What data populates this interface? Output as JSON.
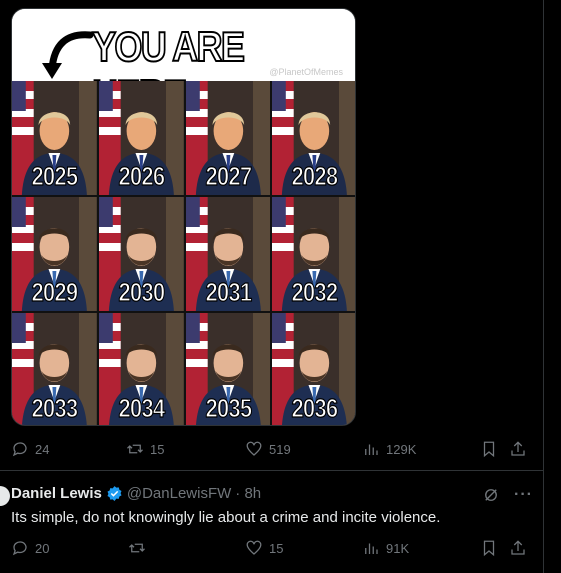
{
  "meme": {
    "title": "YOU ARE HERE.",
    "credit": "@PlanetOfMemes",
    "cells": [
      {
        "year": "2025",
        "person": "trump"
      },
      {
        "year": "2026",
        "person": "trump"
      },
      {
        "year": "2027",
        "person": "trump"
      },
      {
        "year": "2028",
        "person": "trump"
      },
      {
        "year": "2029",
        "person": "vance"
      },
      {
        "year": "2030",
        "person": "vance"
      },
      {
        "year": "2031",
        "person": "vance"
      },
      {
        "year": "2032",
        "person": "vance"
      },
      {
        "year": "2033",
        "person": "vance"
      },
      {
        "year": "2034",
        "person": "vance"
      },
      {
        "year": "2035",
        "person": "vance"
      },
      {
        "year": "2036",
        "person": "vance"
      }
    ]
  },
  "post_actions": {
    "replies": "24",
    "reposts": "15",
    "likes": "519",
    "views": "129K"
  },
  "reply": {
    "name": "Daniel Lewis",
    "handle": "@DanLewisFW",
    "time": "· 8h",
    "text": "Its simple, do not knowingly lie about a crime and incite violence.",
    "more_label": "···",
    "actions": {
      "replies": "20",
      "reposts": "",
      "likes": "15",
      "views": "91K"
    }
  },
  "colors": {
    "background": "#000000",
    "muted": "#71767b",
    "text": "#e7e9ea",
    "verified": "#1d9bf0",
    "divider": "#2f3336"
  }
}
